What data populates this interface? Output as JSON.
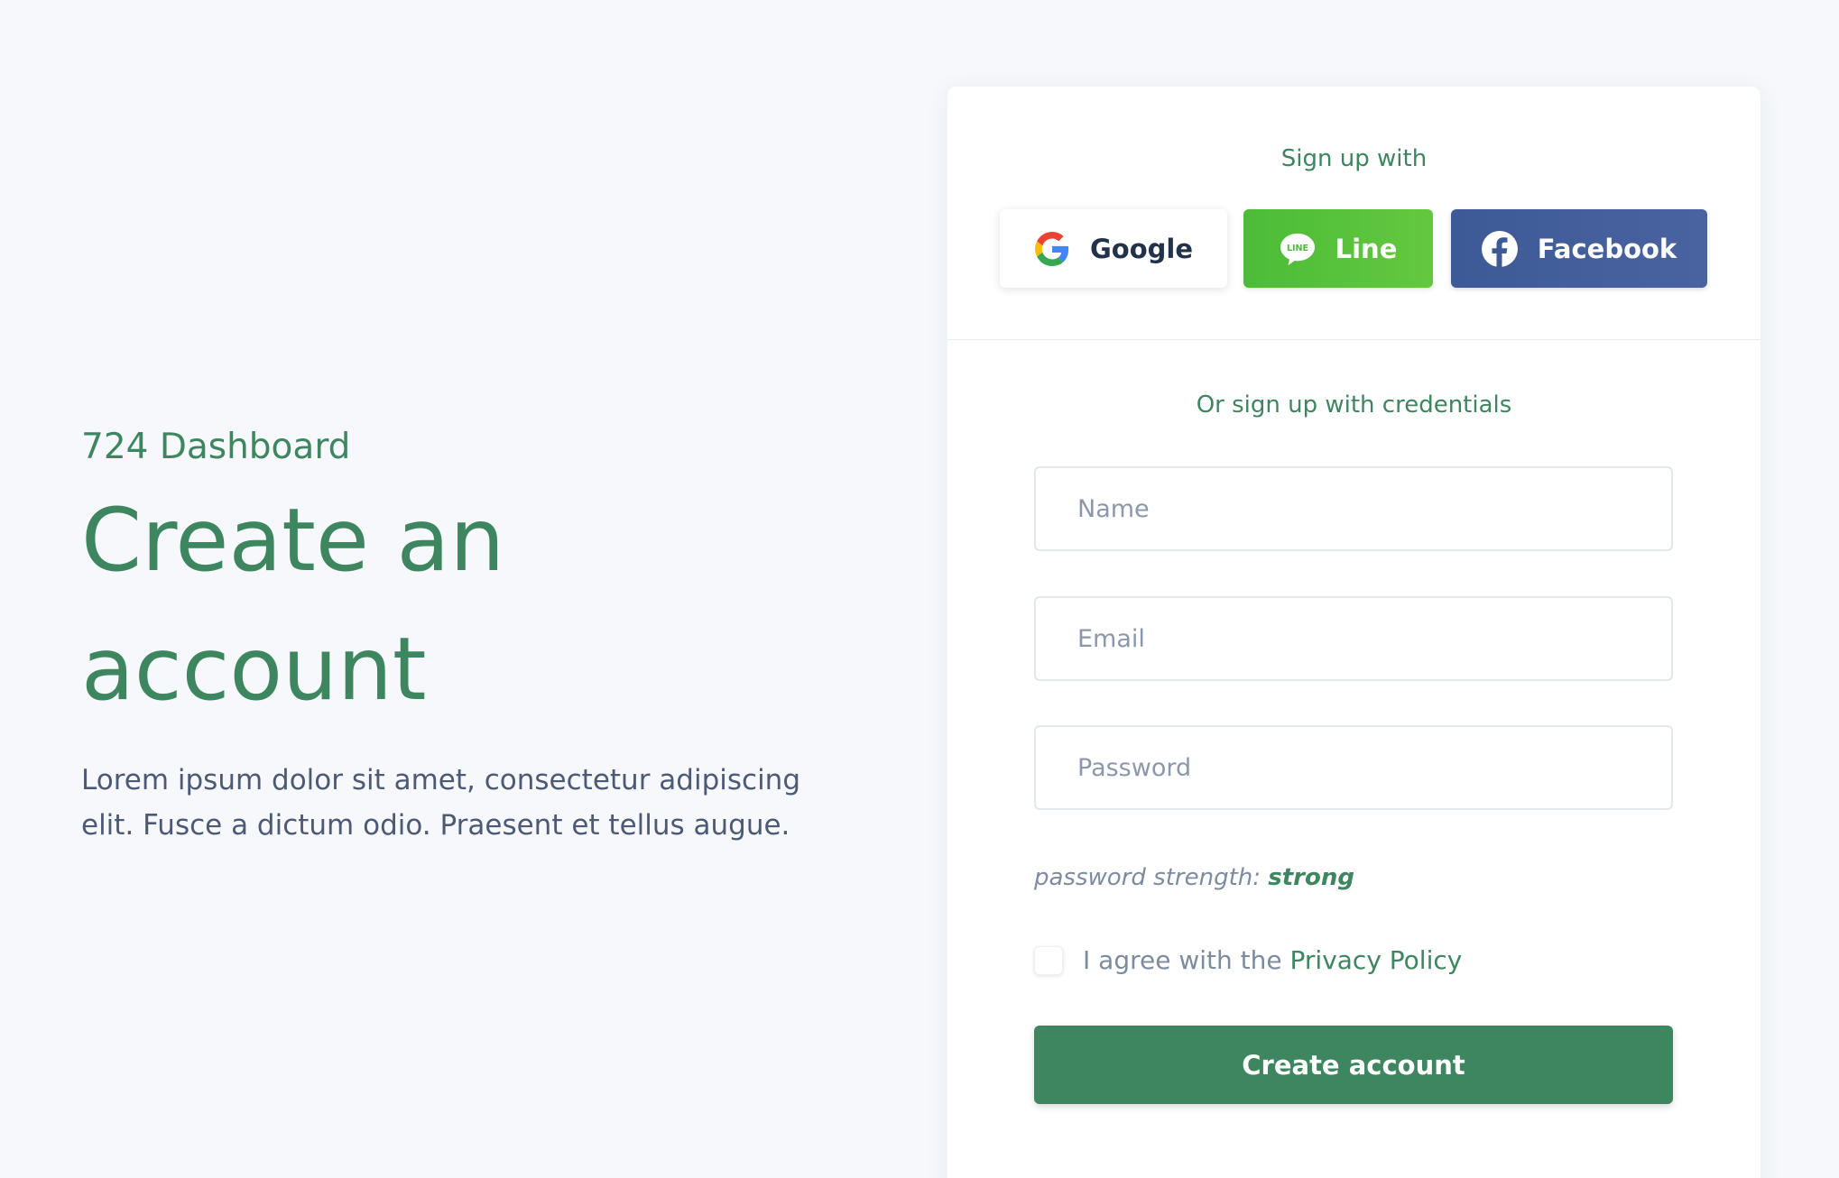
{
  "hero": {
    "brand": "724 Dashboard",
    "headline": "Create an account",
    "description": "Lorem ipsum dolor sit amet, consectetur adipiscing elit. Fusce a dictum odio. Praesent et tellus augue."
  },
  "social": {
    "title": "Sign up with",
    "buttons": [
      {
        "label": "Google",
        "icon": "google-icon"
      },
      {
        "label": "Line",
        "icon": "line-icon"
      },
      {
        "label": "Facebook",
        "icon": "facebook-icon"
      }
    ]
  },
  "form": {
    "title": "Or sign up with credentials",
    "name_placeholder": "Name",
    "email_placeholder": "Email",
    "password_placeholder": "Password",
    "strength_label": "password strength:",
    "strength_value": "strong",
    "agree_text": "I agree with the",
    "agree_link": "Privacy Policy",
    "submit_label": "Create account"
  },
  "colors": {
    "accent": "#3d8660",
    "line": "#4cbc38",
    "facebook": "#3d5a96",
    "background": "#f6f8fb"
  }
}
